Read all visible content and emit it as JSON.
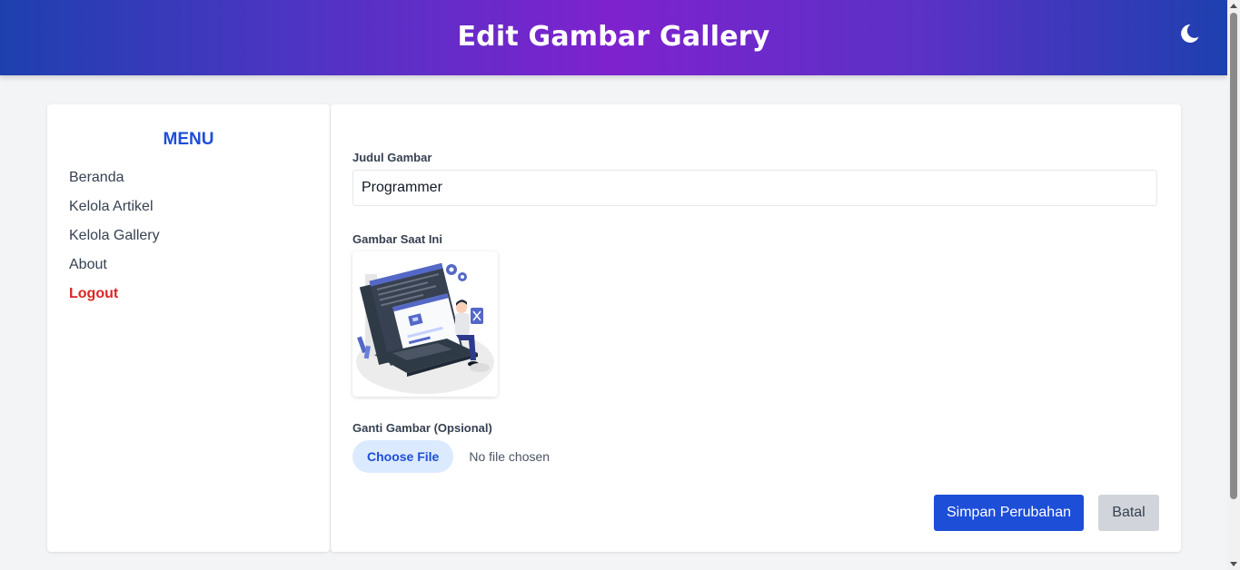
{
  "header": {
    "title": "Edit Gambar Gallery",
    "theme_icon": "moon-icon"
  },
  "sidebar": {
    "title": "MENU",
    "items": [
      {
        "label": "Beranda"
      },
      {
        "label": "Kelola Artikel"
      },
      {
        "label": "Kelola Gallery"
      },
      {
        "label": "About"
      },
      {
        "label": "Logout"
      }
    ]
  },
  "form": {
    "title_label": "Judul Gambar",
    "title_value": "Programmer",
    "current_image_label": "Gambar Saat Ini",
    "current_image_icon": "programmer-laptop-illustration",
    "replace_label": "Ganti Gambar (Opsional)",
    "choose_file_label": "Choose File",
    "file_status": "No file chosen",
    "save_label": "Simpan Perubahan",
    "cancel_label": "Batal"
  },
  "colors": {
    "header_gradient_edge": "#1e40af",
    "header_gradient_center": "#7e22ce",
    "accent": "#1d4ed8",
    "logout": "#dc2626",
    "cancel_bg": "#d1d5db",
    "choose_file_bg": "#dbeafe",
    "page_bg": "#f3f4f6"
  }
}
